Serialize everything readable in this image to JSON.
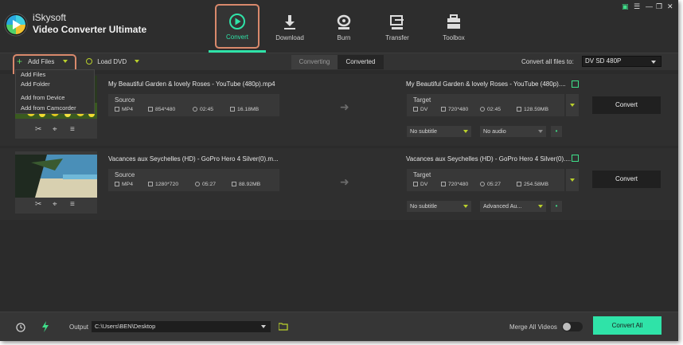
{
  "app": {
    "brand_line1": "iSkysoft",
    "brand_line2": "Video Converter Ultimate"
  },
  "nav": {
    "tabs": [
      {
        "label": "Convert",
        "icon": "convert-play-icon",
        "active": true
      },
      {
        "label": "Download",
        "icon": "download-icon",
        "active": false
      },
      {
        "label": "Burn",
        "icon": "burn-disc-icon",
        "active": false
      },
      {
        "label": "Transfer",
        "icon": "transfer-icon",
        "active": false
      },
      {
        "label": "Toolbox",
        "icon": "toolbox-icon",
        "active": false
      }
    ]
  },
  "window_controls": [
    "gift-icon",
    "settings-icon",
    "minimize-icon",
    "restore-icon",
    "close-icon"
  ],
  "toolbar": {
    "add_files": "Add Files",
    "load_dvd": "Load DVD",
    "segment_converting": "Converting",
    "segment_converted": "Converted",
    "convert_all_to_label": "Convert all files to:",
    "convert_all_to_value": "DV SD 480P"
  },
  "add_menu": {
    "items": [
      "Add Files",
      "Add Folder",
      "Add from Device",
      "Add from Camcorder"
    ]
  },
  "files": [
    {
      "title": "My Beautiful Garden & lovely Roses - YouTube (480p).mp4",
      "source_label": "Source",
      "source_format": "MP4",
      "source_resolution": "854*480",
      "source_duration": "02:45",
      "source_size": "16.18MB",
      "target_title": "My Beautiful Garden & lovely Roses - YouTube (480p)....",
      "target_label": "Target",
      "target_format": "DV",
      "target_resolution": "720*480",
      "target_duration": "02:45",
      "target_size": "128.59MB",
      "subtitle": "No subtitle",
      "audio": "No audio",
      "convert_label": "Convert"
    },
    {
      "title": "Vacances aux Seychelles (HD) - GoPro Hero 4 Silver(0).m...",
      "source_label": "Source",
      "source_format": "MP4",
      "source_resolution": "1280*720",
      "source_duration": "05:27",
      "source_size": "88.92MB",
      "target_title": "Vacances aux Seychelles (HD) - GoPro Hero 4 Silver(0)....",
      "target_label": "Target",
      "target_format": "DV",
      "target_resolution": "720*480",
      "target_duration": "05:27",
      "target_size": "254.58MB",
      "subtitle": "No subtitle",
      "audio": "Advanced Au...",
      "convert_label": "Convert"
    }
  ],
  "footer": {
    "output_label": "Output",
    "output_path": "C:\\Users\\BEN\\Desktop",
    "merge_label": "Merge All Videos",
    "merge_on": false,
    "convert_all": "Convert All"
  },
  "colors": {
    "accent": "#2fe3a8",
    "highlight_outline": "#d9896c",
    "background": "#2b2b2b"
  }
}
